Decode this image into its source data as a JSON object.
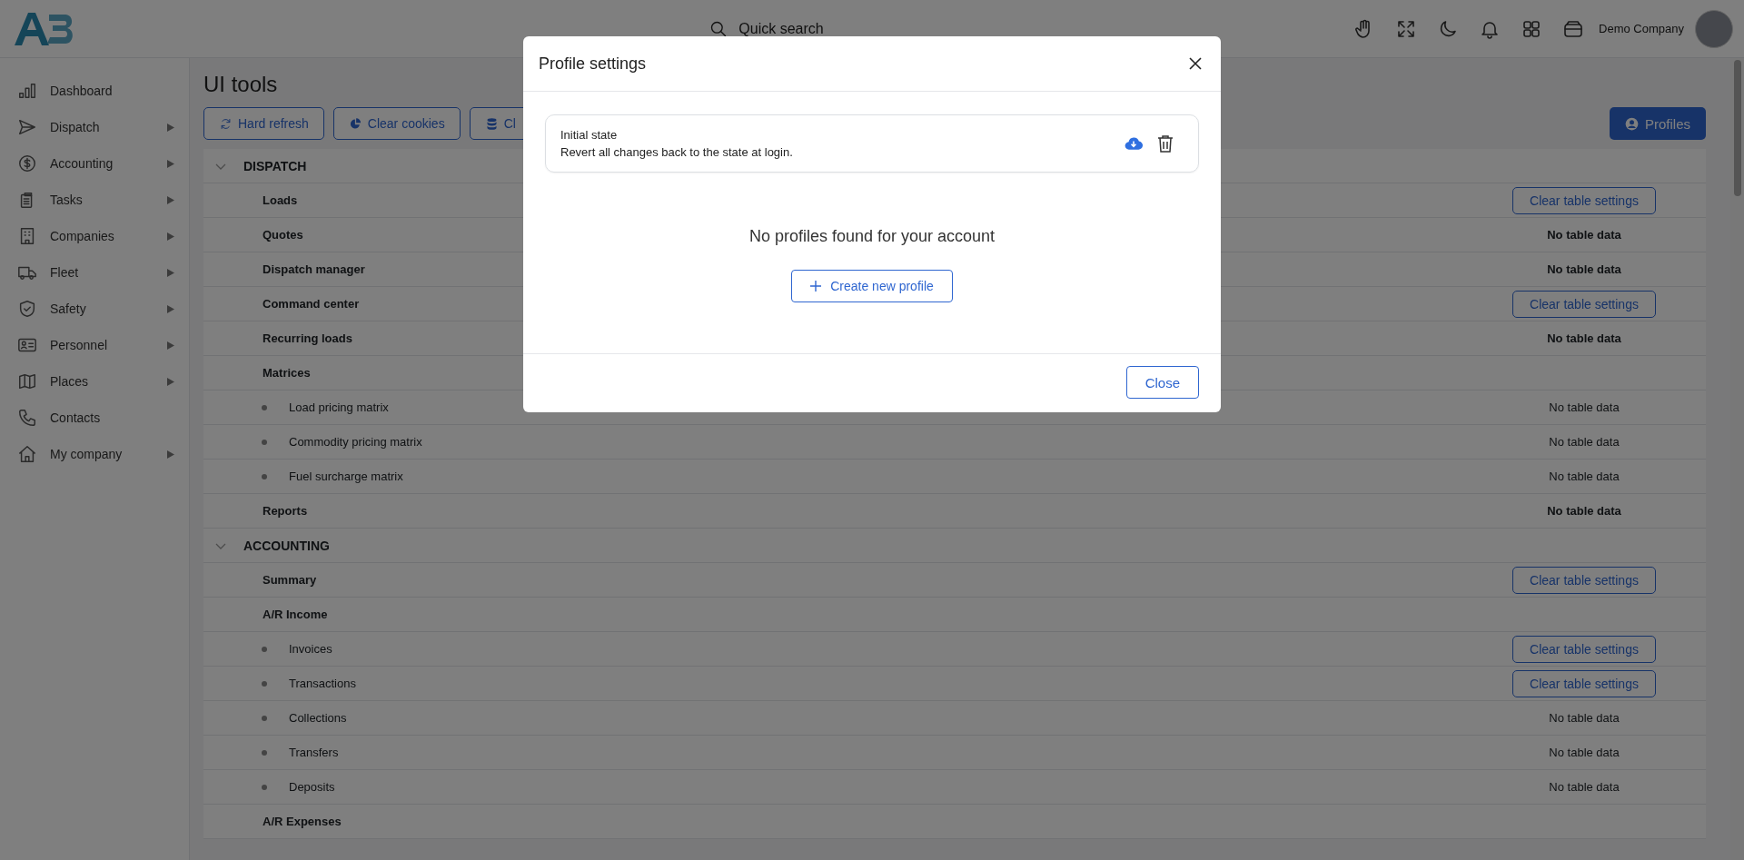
{
  "header": {
    "quick_search": "Quick search",
    "company": "Demo Company"
  },
  "sidebar": {
    "items": [
      {
        "label": "Dashboard",
        "has_submenu": false
      },
      {
        "label": "Dispatch",
        "has_submenu": true
      },
      {
        "label": "Accounting",
        "has_submenu": true
      },
      {
        "label": "Tasks",
        "has_submenu": true
      },
      {
        "label": "Companies",
        "has_submenu": true
      },
      {
        "label": "Fleet",
        "has_submenu": true
      },
      {
        "label": "Safety",
        "has_submenu": true
      },
      {
        "label": "Personnel",
        "has_submenu": true
      },
      {
        "label": "Places",
        "has_submenu": true
      },
      {
        "label": "Contacts",
        "has_submenu": false
      },
      {
        "label": "My company",
        "has_submenu": true
      }
    ]
  },
  "page": {
    "title": "UI tools",
    "toolbar": [
      {
        "label": "Hard refresh"
      },
      {
        "label": "Clear cookies"
      },
      {
        "label": "Cl"
      }
    ],
    "profiles_button": "Profiles"
  },
  "table": {
    "sections": [
      {
        "title": "DISPATCH",
        "expanded": true,
        "rows": [
          {
            "label": "Loads",
            "kind": "item",
            "action": {
              "kind": "button",
              "label": "Clear table settings"
            }
          },
          {
            "label": "Quotes",
            "kind": "item",
            "action": {
              "kind": "text",
              "label": "No table data"
            }
          },
          {
            "label": "Dispatch manager",
            "kind": "item",
            "action": {
              "kind": "text",
              "label": "No table data"
            }
          },
          {
            "label": "Command center",
            "kind": "item",
            "action": {
              "kind": "button",
              "label": "Clear table settings"
            }
          },
          {
            "label": "Recurring loads",
            "kind": "item",
            "action": {
              "kind": "text",
              "label": "No table data"
            }
          },
          {
            "label": "Matrices",
            "kind": "item"
          },
          {
            "label": "Load pricing matrix",
            "kind": "subitem",
            "action": {
              "kind": "text",
              "label": "No table data"
            }
          },
          {
            "label": "Commodity pricing matrix",
            "kind": "subitem",
            "action": {
              "kind": "text",
              "label": "No table data"
            }
          },
          {
            "label": "Fuel surcharge matrix",
            "kind": "subitem",
            "action": {
              "kind": "text",
              "label": "No table data"
            }
          },
          {
            "label": "Reports",
            "kind": "item",
            "action": {
              "kind": "text",
              "label": "No table data"
            }
          }
        ]
      },
      {
        "title": "ACCOUNTING",
        "expanded": true,
        "rows": [
          {
            "label": "Summary",
            "kind": "item",
            "action": {
              "kind": "button",
              "label": "Clear table settings"
            }
          },
          {
            "label": "A/R Income",
            "kind": "item"
          },
          {
            "label": "Invoices",
            "kind": "subitem",
            "action": {
              "kind": "button",
              "label": "Clear table settings"
            }
          },
          {
            "label": "Transactions",
            "kind": "subitem",
            "action": {
              "kind": "button",
              "label": "Clear table settings"
            }
          },
          {
            "label": "Collections",
            "kind": "subitem",
            "action": {
              "kind": "text",
              "label": "No table data"
            }
          },
          {
            "label": "Transfers",
            "kind": "subitem",
            "action": {
              "kind": "text",
              "label": "No table data"
            }
          },
          {
            "label": "Deposits",
            "kind": "subitem",
            "action": {
              "kind": "text",
              "label": "No table data"
            }
          },
          {
            "label": "A/R Expenses",
            "kind": "item"
          }
        ]
      }
    ]
  },
  "modal": {
    "title": "Profile settings",
    "profile": {
      "title": "Initial state",
      "description": "Revert all changes back to the state at login."
    },
    "empty_text": "No profiles found for your account",
    "create_button": "Create new profile",
    "close_button": "Close"
  }
}
